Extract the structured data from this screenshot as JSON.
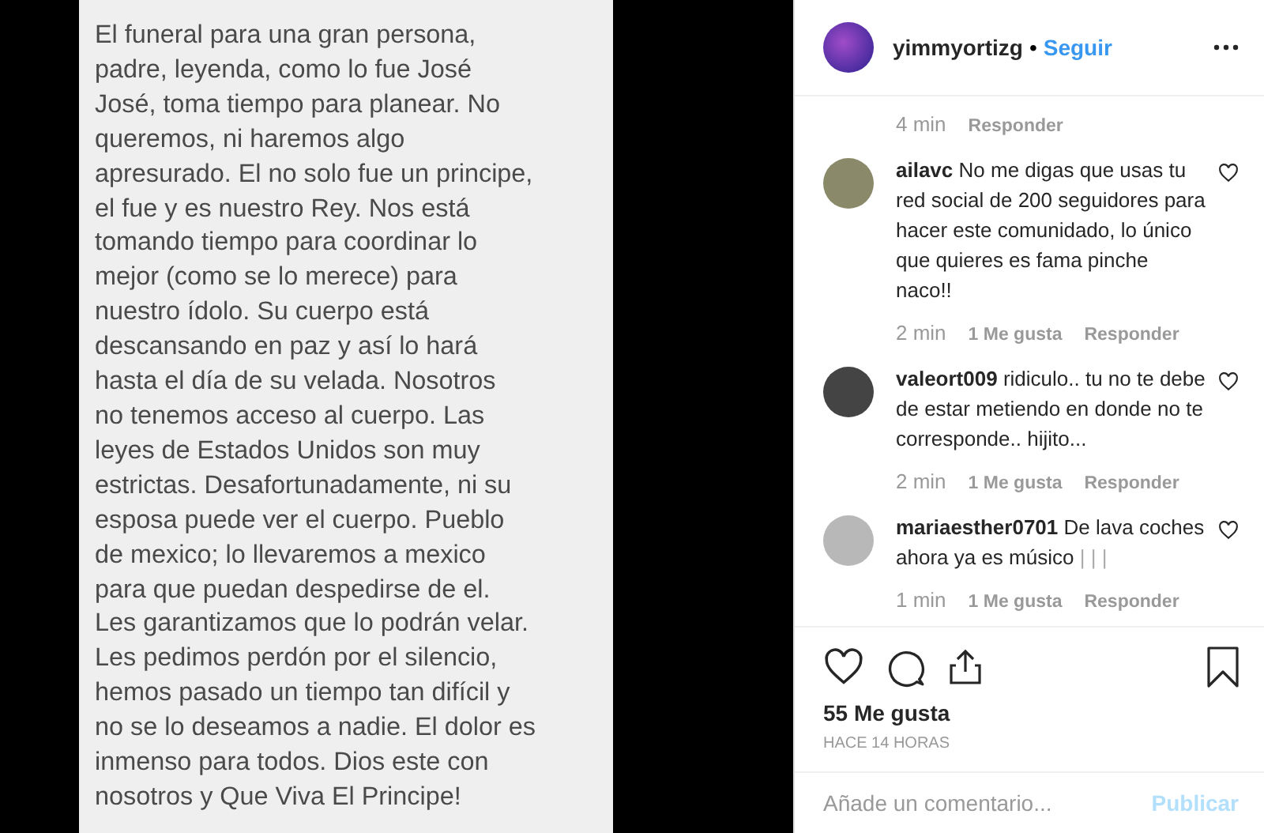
{
  "post_image": {
    "text": "El funeral para una gran persona,\npadre, leyenda, como lo fue José\nJosé, toma tiempo para planear. No\nqueremos, ni haremos algo\napresurado. El no solo fue un principe,\nel fue y es nuestro Rey. Nos está\ntomando tiempo para coordinar lo\nmejor (como se lo merece) para\nnuestro ídolo. Su cuerpo está\ndescansando en paz y así lo hará\nhasta el día de su velada. Nosotros\nno tenemos acceso al cuerpo. Las\nleyes de Estados Unidos son muy\nestrictas. Desafortunadamente, ni su\nesposa puede ver el cuerpo. Pueblo\nde mexico; lo llevaremos a mexico\npara que puedan despedirse de el.\nLes garantizamos que lo podrán velar.\nLes pedimos perdón por el silencio,\nhemos pasado un tiempo tan difícil y\nno se lo deseamos a nadie. El dolor es\ninmenso para todos. Dios este con\nnosotros y Que Viva El Principe!"
  },
  "header": {
    "username": "yimmyortizg",
    "separator": "•",
    "follow": "Seguir"
  },
  "caption_meta": {
    "time": "4 min",
    "reply": "Responder"
  },
  "comments": [
    {
      "username": "ailavc",
      "text": "No me digas que usas tu red social de 200 seguidores para hacer este comunidado, lo único que quieres es fama pinche naco!!",
      "time": "2 min",
      "likes": "1 Me gusta",
      "reply": "Responder"
    },
    {
      "username": "valeort009",
      "text": "ridiculo.. tu no te debe de estar metiendo en donde no te corresponde.. hijito...",
      "time": "2 min",
      "likes": "1 Me gusta",
      "reply": "Responder"
    },
    {
      "username": "mariaesther0701",
      "text": "De lava coches ahora ya es músico",
      "trailing": "| | |",
      "time": "1 min",
      "likes": "1 Me gusta",
      "reply": "Responder"
    }
  ],
  "likes": "55 Me gusta",
  "posted": "HACE 14 HORAS",
  "comment_box": {
    "placeholder": "Añade un comentario...",
    "submit": "Publicar"
  }
}
